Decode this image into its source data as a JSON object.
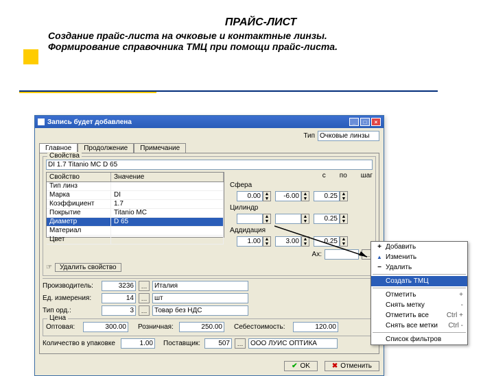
{
  "slide": {
    "title1": "ПРАЙС-ЛИСТ",
    "title2": "Создание  прайс-листа  на очковые  и контактные линзы.",
    "title3": "Формирование справочника ТМЦ при помощи прайс-листа."
  },
  "window": {
    "title": "Запись будет добавлена",
    "type_label": "Тип",
    "type_value": "Очковые линзы",
    "tabs": {
      "t1": "Главное",
      "t2": "Продолжение",
      "t3": "Примечание"
    },
    "props_caption": "Свойства",
    "props_value": "DI 1.7 Titanio MC D 65",
    "grid_headers": {
      "c1": "Свойство",
      "c2": "Значение"
    },
    "grid_rows": [
      {
        "p": "Тип линз",
        "v": ""
      },
      {
        "p": "Марка",
        "v": "DI"
      },
      {
        "p": "Коэффициент",
        "v": "1.7"
      },
      {
        "p": "Покрытие",
        "v": "Titanio MC"
      },
      {
        "p": "Диаметр",
        "v": "D 65"
      },
      {
        "p": "Материал",
        "v": ""
      },
      {
        "p": "Цвет",
        "v": ""
      }
    ],
    "selected_row": 4,
    "range_labels": {
      "from": "с",
      "to": "по",
      "step": "шаг"
    },
    "sphere_label": "Сфера",
    "sphere": {
      "from": "0.00",
      "to": "-6.00",
      "step": "0.25"
    },
    "cylinder_label": "Цилиндр",
    "cylinder": {
      "step": "0.25"
    },
    "addidation_label": "Аддидация",
    "addidation": {
      "from": "1.00",
      "to": "3.00",
      "step": "0.25"
    },
    "ax_label": "Ax:",
    "delete_prop_btn": "Удалить свойство",
    "manufacturer_label": "Производитель:",
    "manufacturer_id": "3236",
    "manufacturer_name": "Италия",
    "unit_label": "Ед. измерения:",
    "unit_id": "14",
    "unit_name": "шт",
    "order_type_label": "Тип орд.:",
    "order_type_id": "3",
    "order_type_name": "Товар без НДС",
    "price_caption": "Цена",
    "wholesale_label": "Оптовая:",
    "wholesale": "300.00",
    "retail_label": "Розничная:",
    "retail": "250.00",
    "cost_label": "Себестоимость:",
    "cost": "120.00",
    "pack_qty_label": "Количество в упаковке",
    "pack_qty": "1.00",
    "supplier_label": "Поставщик:",
    "supplier_id": "507",
    "supplier_name": "ООО ЛУИС ОПТИКА",
    "ok": "OK",
    "cancel": "Отменить"
  },
  "menu": {
    "add": "Добавить",
    "edit": "Изменить",
    "delete": "Удалить",
    "create_tmc": "Создать ТМЦ",
    "mark": "Отметить",
    "mark_key": "+",
    "unmark": "Снять метку",
    "unmark_key": "-",
    "mark_all": "Отметить все",
    "mark_all_key": "Ctrl +",
    "unmark_all": "Снять все метки",
    "unmark_all_key": "Ctrl -",
    "filter_list": "Список фильтров"
  }
}
